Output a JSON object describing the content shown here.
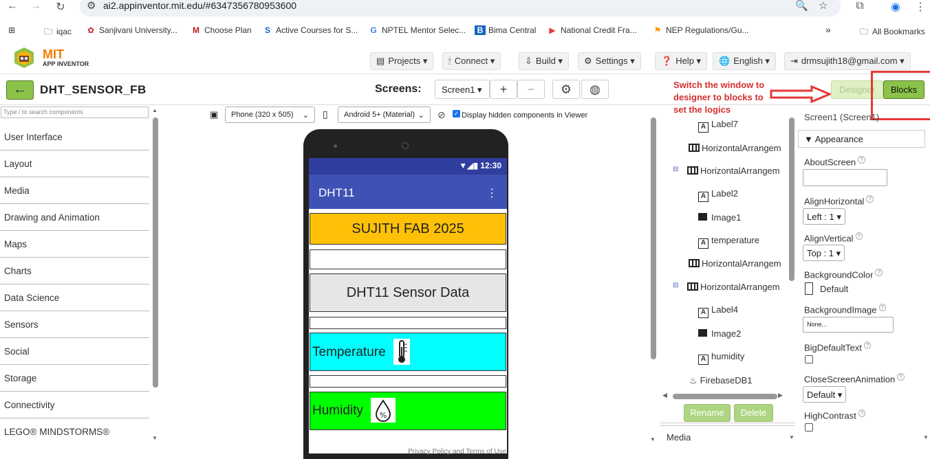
{
  "browser": {
    "url": "ai2.appinventor.mit.edu/#6347356780953600",
    "bookmarks": [
      {
        "label": "iqac",
        "icon": "folder-icon"
      },
      {
        "label": "Sanjivani University...",
        "icon": "site-icon"
      },
      {
        "label": "Choose Plan",
        "icon": "site-icon"
      },
      {
        "label": "Active Courses for S...",
        "icon": "site-icon"
      },
      {
        "label": "NPTEL Mentor Selec...",
        "icon": "google-icon"
      },
      {
        "label": "Bima Central",
        "icon": "site-icon"
      },
      {
        "label": "National Credit Fra...",
        "icon": "youtube-icon"
      },
      {
        "label": "NEP Regulations/Gu...",
        "icon": "flag-icon"
      }
    ],
    "all_bookmarks": "All Bookmarks",
    "more": "»"
  },
  "app": {
    "logo_top": "MIT",
    "logo_bottom": "APP INVENTOR",
    "menu": {
      "projects": "Projects ▾",
      "connect": "Connect ▾",
      "build": "Build ▾",
      "settings": "Settings ▾",
      "help": "Help ▾",
      "language": "English ▾",
      "account": "drmsujith18@gmail.com ▾"
    }
  },
  "project": {
    "name": "DHT_SENSOR_FB",
    "screens_label": "Screens:",
    "screen_selected": "Screen1 ▾",
    "add": "+",
    "remove": "−",
    "designer": "Designer",
    "blocks": "Blocks",
    "annotation": "Switch the window to designer to blocks to set the logics"
  },
  "palette": {
    "search_placeholder": "Type / to search components",
    "items": [
      "User Interface",
      "Layout",
      "Media",
      "Drawing and Animation",
      "Maps",
      "Charts",
      "Data Science",
      "Sensors",
      "Social",
      "Storage",
      "Connectivity",
      "LEGO® MINDSTORMS®"
    ]
  },
  "viewer": {
    "device_size": "Phone (320 x 505)",
    "theme": "Android 5+ (Material)",
    "hidden_label": "Display hidden components in Viewer",
    "status_time": "12:30",
    "app_title": "DHT11",
    "menu_dots": "⋮",
    "title_text": "SUJITH FAB 2025",
    "subtitle_text": "DHT11 Sensor Data",
    "temp_label": "Temperature",
    "hum_label": "Humidity",
    "colors": {
      "title_bg": "#ffc107",
      "sensor_bg": "#e6e6e6",
      "temp_bg": "#00ffff",
      "hum_bg": "#00ff00"
    }
  },
  "tree": {
    "nodes": [
      "Label7",
      "HorizontalArrangem",
      "HorizontalArrangem",
      "Label2",
      "Image1",
      "temperature",
      "HorizontalArrangem",
      "HorizontalArrangem",
      "Label4",
      "Image2",
      "humidity",
      "FirebaseDB1"
    ],
    "rename": "Rename",
    "delete": "Delete",
    "media": "Media"
  },
  "properties": {
    "header": "Screen1 (Screen1)",
    "section": "Appearance",
    "about": "AboutScreen",
    "align_h": "AlignHorizontal",
    "align_h_val": "Left : 1 ▾",
    "align_v": "AlignVertical",
    "align_v_val": "Top : 1 ▾",
    "bg_color": "BackgroundColor",
    "bg_color_val": "Default",
    "bg_image": "BackgroundImage",
    "bg_image_val": "None...",
    "big_text": "BigDefaultText",
    "close_anim": "CloseScreenAnimation",
    "close_anim_val": "Default ▾",
    "high_contrast": "HighContrast",
    "help_mark": "?"
  },
  "footer": "Privacy Policy and Terms of Use"
}
